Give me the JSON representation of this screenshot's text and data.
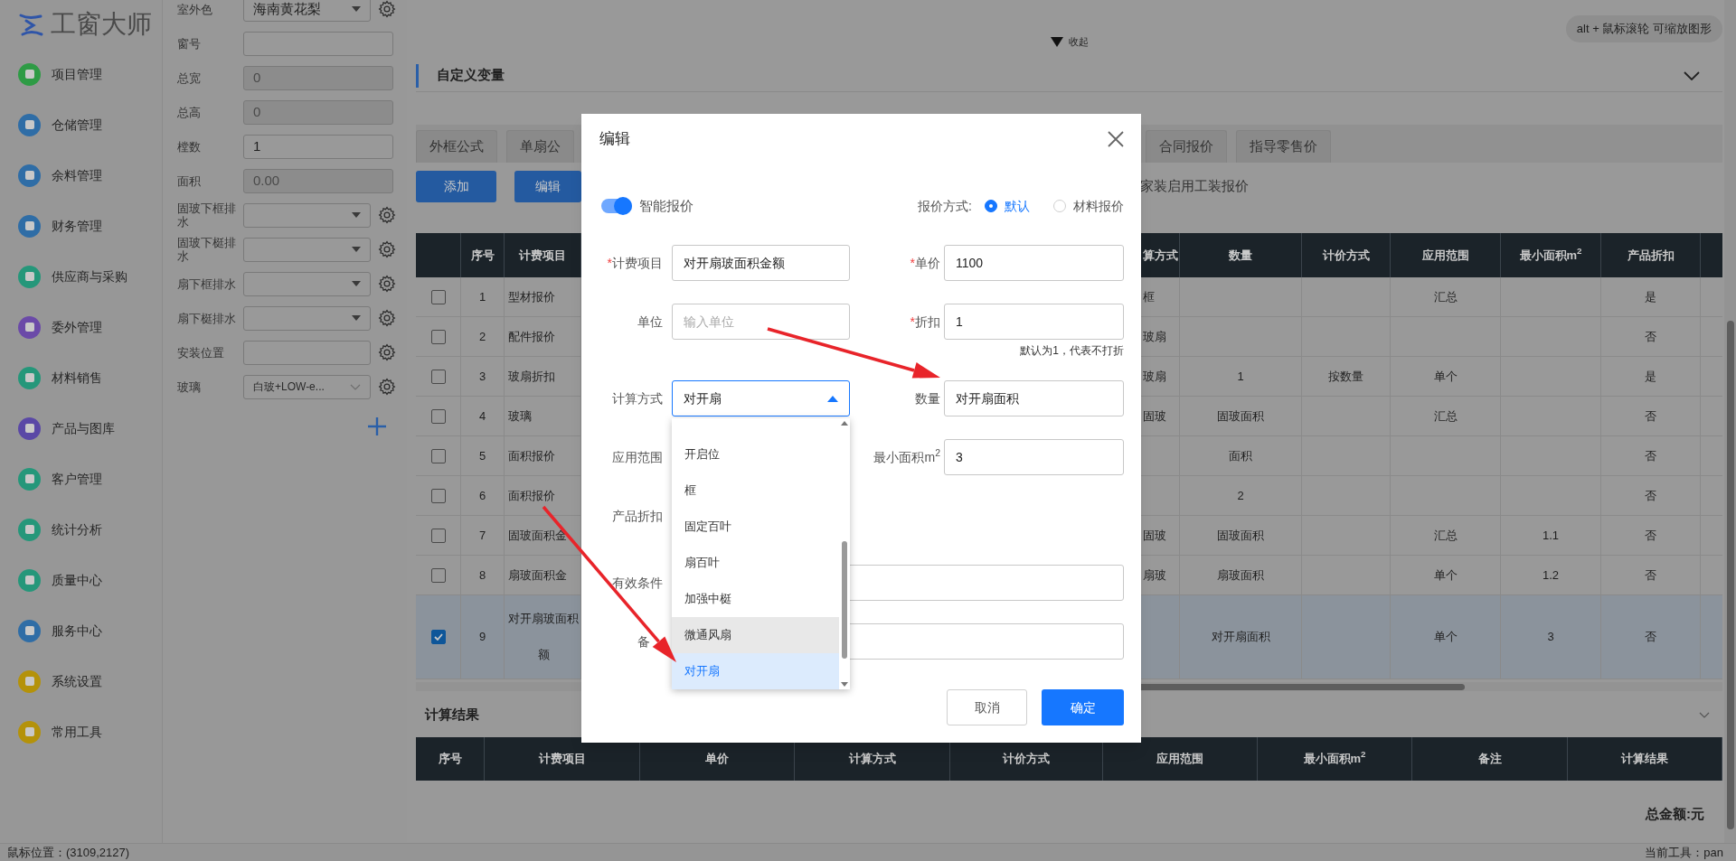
{
  "sidebar": {
    "logo": "工窗大师",
    "items": [
      {
        "label": "项目管理",
        "color": "#2e9b45"
      },
      {
        "label": "仓储管理",
        "color": "#2f6da6"
      },
      {
        "label": "余料管理",
        "color": "#2f6da6"
      },
      {
        "label": "财务管理",
        "color": "#2f6da6"
      },
      {
        "label": "供应商与采购",
        "color": "#25977a"
      },
      {
        "label": "委外管理",
        "color": "#6b4aa8"
      },
      {
        "label": "材料销售",
        "color": "#25977a"
      },
      {
        "label": "产品与图库",
        "color": "#5a48a6"
      },
      {
        "label": "客户管理",
        "color": "#25977a"
      },
      {
        "label": "统计分析",
        "color": "#25977a"
      },
      {
        "label": "质量中心",
        "color": "#25977a"
      },
      {
        "label": "服务中心",
        "color": "#2f6da6"
      },
      {
        "label": "系统设置",
        "color": "#b4920a"
      },
      {
        "label": "常用工具",
        "color": "#b4920a"
      }
    ]
  },
  "form_panel": {
    "fields": [
      {
        "label": "室外色",
        "kind": "select",
        "value": "海南黄花梨",
        "disabled": false,
        "gear": true
      },
      {
        "label": "窗号",
        "kind": "input",
        "disabled": false,
        "gear": false
      },
      {
        "label": "总宽",
        "kind": "input",
        "value": "0",
        "disabled": true,
        "gear": false
      },
      {
        "label": "总高",
        "kind": "input",
        "value": "0",
        "disabled": true,
        "gear": false
      },
      {
        "label": "樘数",
        "kind": "input",
        "value": "1",
        "disabled": false,
        "gear": false
      },
      {
        "label": "面积",
        "kind": "input",
        "value": "0.00",
        "disabled": true,
        "gear": false
      },
      {
        "label": "固玻下框排水",
        "kind": "select",
        "disabled": false,
        "gear": true
      },
      {
        "label": "固玻下梃排水",
        "kind": "select",
        "disabled": false,
        "gear": true
      },
      {
        "label": "扇下框排水",
        "kind": "select",
        "disabled": false,
        "gear": true
      },
      {
        "label": "扇下梃排水",
        "kind": "select",
        "disabled": false,
        "gear": true
      },
      {
        "label": "安装位置",
        "kind": "input",
        "disabled": false,
        "gear": true
      },
      {
        "label": "玻璃",
        "kind": "combo",
        "value": "白玻+LOW-e...",
        "disabled": false,
        "gear": true
      }
    ]
  },
  "collapse_toggle": {
    "label": "收起"
  },
  "zoom_hint": "alt + 鼠标滚轮 可缩放图形",
  "section": {
    "title": "自定义变量"
  },
  "tabs": [
    {
      "label": "外框公式",
      "selected": false
    },
    {
      "label": "单扇公",
      "selected": false
    },
    {
      "label": "合同报价",
      "selected": false
    },
    {
      "label": "指导零售价",
      "selected": false
    }
  ],
  "toolbar": {
    "buttons": [
      "添加",
      "编辑"
    ],
    "note": "家装启用工装报价"
  },
  "table": {
    "columns": [
      "序号",
      "计费项目",
      "算方式",
      "数量",
      "计价方式",
      "应用范围",
      "最小面积m$^{2}$",
      "产品折扣"
    ],
    "rows": [
      {
        "checked": false,
        "selected": false,
        "cells": [
          "1",
          "型材报价",
          "框",
          null,
          null,
          "汇总",
          null,
          "是"
        ]
      },
      {
        "checked": false,
        "selected": false,
        "cells": [
          "2",
          "配件报价",
          "玻扇",
          null,
          null,
          null,
          null,
          "否"
        ]
      },
      {
        "checked": false,
        "selected": false,
        "cells": [
          "3",
          "玻扇折扣",
          "玻扇",
          "1",
          "按数量",
          "单个",
          null,
          "是"
        ]
      },
      {
        "checked": false,
        "selected": false,
        "cells": [
          "4",
          "玻璃",
          "固玻",
          "固玻面积",
          null,
          "汇总",
          null,
          "否"
        ]
      },
      {
        "checked": false,
        "selected": false,
        "cells": [
          "5",
          "面积报价",
          null,
          "面积",
          null,
          null,
          null,
          "否"
        ]
      },
      {
        "checked": false,
        "selected": false,
        "cells": [
          "6",
          "面积报价",
          null,
          "2",
          null,
          null,
          null,
          "否"
        ]
      },
      {
        "checked": false,
        "selected": false,
        "cells": [
          "7",
          "固玻面积金",
          "固玻",
          "固玻面积",
          null,
          "汇总",
          "1.1",
          "否"
        ]
      },
      {
        "checked": false,
        "selected": false,
        "cells": [
          "8",
          "扇玻面积金",
          "扇玻",
          "扇玻面积",
          null,
          "单个",
          "1.2",
          "否"
        ]
      },
      {
        "checked": true,
        "selected": true,
        "cells": [
          "9",
          "对开扇玻面积额",
          null,
          "对开扇面积",
          null,
          "单个",
          "3",
          "否"
        ]
      }
    ]
  },
  "results": {
    "title": "计算结果",
    "columns": [
      "序号",
      "计费项目",
      "单价",
      "计算方式",
      "计价方式",
      "应用范围",
      "最小面积m$^{2}$",
      "备注",
      "计算结果"
    ],
    "total": "总金额:元"
  },
  "status_bar": {
    "left": "鼠标位置：(3109,2127)",
    "right": "当前工具：pan"
  },
  "modal": {
    "title": "编辑",
    "required_mark": "*",
    "smart_quote": {
      "label": "智能报价",
      "on": true
    },
    "quote_method": {
      "label": "报价方式:",
      "options": [
        {
          "label": "默认",
          "selected": true
        },
        {
          "label": "材料报价",
          "selected": false
        }
      ]
    },
    "rows": [
      {
        "left": {
          "label": "计费项目",
          "required": true,
          "kind": "input",
          "value": "对开扇玻面积金额"
        },
        "right": {
          "label": "单价",
          "required": true,
          "kind": "input",
          "value": "1100"
        }
      },
      {
        "left": {
          "label": "单位",
          "required": false,
          "kind": "input",
          "placeholder": "输入单位"
        },
        "right": {
          "label": "折扣",
          "required": true,
          "kind": "input",
          "value": "1",
          "hint": "默认为1，代表不打折"
        }
      },
      {
        "left": {
          "label": "计算方式",
          "required": false,
          "kind": "select",
          "value": "对开扇",
          "expanded": true
        },
        "right": {
          "label": "数量",
          "required": false,
          "kind": "input",
          "value": "对开扇面积"
        }
      },
      {
        "left": {
          "label": "应用范围",
          "required": false,
          "kind": "covered"
        },
        "right": {
          "label": "最小面积m$^{2}$",
          "required": false,
          "kind": "input",
          "value": "3"
        }
      },
      {
        "left": {
          "label": "产品折扣",
          "required": false,
          "kind": "covered"
        }
      },
      {
        "wide": {
          "label": "有效条件",
          "required": false,
          "kind": "input"
        }
      },
      {
        "wide": {
          "label": "备",
          "required": false,
          "kind": "input"
        }
      }
    ],
    "dropdown": {
      "items": [
        {
          "label": "开启位",
          "selected": false,
          "highlighted": false
        },
        {
          "label": "框",
          "selected": false,
          "highlighted": false
        },
        {
          "label": "固定百叶",
          "selected": false,
          "highlighted": false
        },
        {
          "label": "扇百叶",
          "selected": false,
          "highlighted": false
        },
        {
          "label": "加强中梃",
          "selected": false,
          "highlighted": false
        },
        {
          "label": "微通风扇",
          "selected": false,
          "highlighted": true
        },
        {
          "label": "对开扇",
          "selected": true,
          "highlighted": false
        }
      ]
    },
    "buttons": {
      "cancel": "取消",
      "confirm": "确定"
    }
  }
}
